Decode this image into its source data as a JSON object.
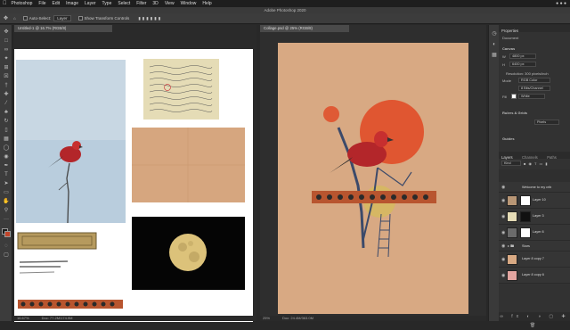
{
  "menubar": {
    "items": [
      "Photoshop",
      "File",
      "Edit",
      "Image",
      "Layer",
      "Type",
      "Select",
      "Filter",
      "3D",
      "View",
      "Window",
      "Help"
    ]
  },
  "titlebar": {
    "title": "Adobe Photoshop 2020"
  },
  "options": {
    "auto_select": "Auto-Select:",
    "layer_select": "Layer",
    "show_transform": "Show Transform Controls"
  },
  "doc1": {
    "tab": "Untitled-1 @ 16.7% (RGB/8)",
    "zoom": "16.67%",
    "status": "Doc: 77.2M/174.9M"
  },
  "doc2": {
    "tab": "Collage.psd @ 25% (RGB/8)",
    "zoom": "25%",
    "status": "Doc: 24.4M/363.0M"
  },
  "properties": {
    "tab": "Properties",
    "section": "Document",
    "canvas": "Canvas",
    "width": "4800 px",
    "height": "6400 px",
    "resolution": "Resolution: 300 pixels/inch",
    "mode": "RGB Color",
    "depth": "8 Bits/Channel",
    "fill": "White",
    "rulers": "Rulers & Grids",
    "unit": "Pixels",
    "guides": "Guides"
  },
  "layers": {
    "tabs": [
      "Layers",
      "Channels",
      "Paths"
    ],
    "kind": "Kind",
    "items": [
      {
        "name": "Welcome to my crib"
      },
      {
        "name": "Layer 10"
      },
      {
        "name": "Layer 3"
      },
      {
        "name": "Layer 8"
      },
      {
        "name": "Stars"
      },
      {
        "name": "Layer 8 copy 7"
      },
      {
        "name": "Layer 8 copy 6"
      }
    ]
  },
  "colors": {
    "accent": "#e0512c",
    "moon": "#e4c26b",
    "canvas": "#d9aa84"
  }
}
